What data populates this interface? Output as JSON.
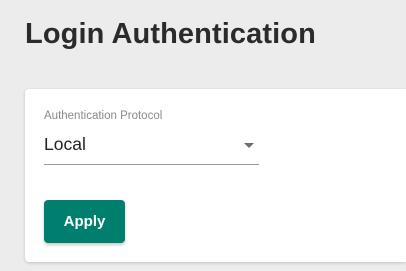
{
  "page": {
    "title": "Login Authentication"
  },
  "form": {
    "protocol_field": {
      "label": "Authentication Protocol",
      "value": "Local",
      "icon": "chevron-down-icon"
    },
    "apply_label": "Apply"
  },
  "colors": {
    "background": "#ececec",
    "card": "#ffffff",
    "primary_button": "#007f6e",
    "title_text": "#2b2b2b",
    "label_text": "#8a8a8a"
  }
}
